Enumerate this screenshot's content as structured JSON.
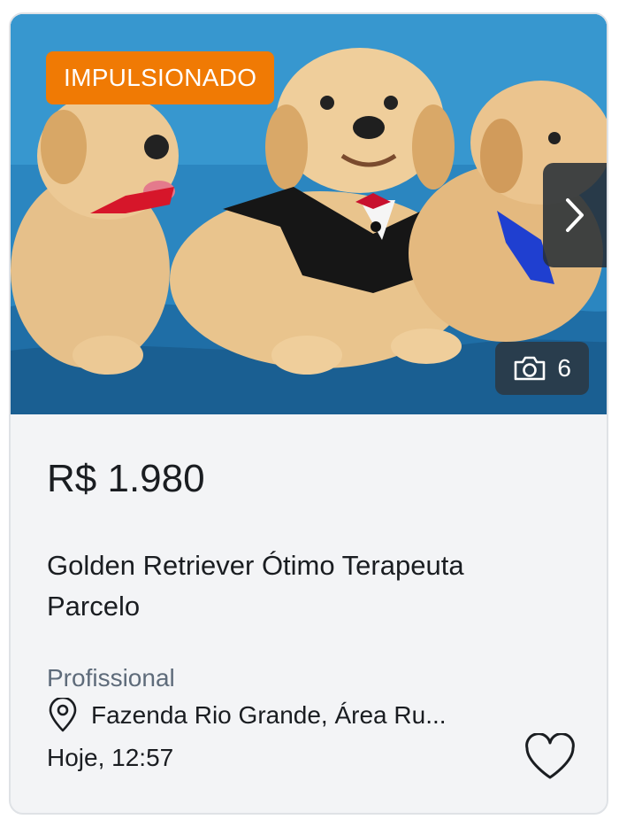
{
  "listing": {
    "badge": "IMPULSIONADO",
    "photo_count": "6",
    "price": "R$ 1.980",
    "title": "Golden Retriever Ótimo Terapeuta Parcelo",
    "seller_type": "Profissional",
    "location": "Fazenda Rio Grande, Área Ru...",
    "date": "Hoje, 12:57"
  },
  "icons": {
    "next": "chevron-right-icon",
    "camera": "camera-icon",
    "location": "location-pin-icon",
    "favorite": "heart-icon"
  },
  "colors": {
    "badge_bg": "#f07a04",
    "card_bg": "#f3f4f6",
    "text_primary": "#1a1d21",
    "text_secondary": "#5e6b7a"
  }
}
